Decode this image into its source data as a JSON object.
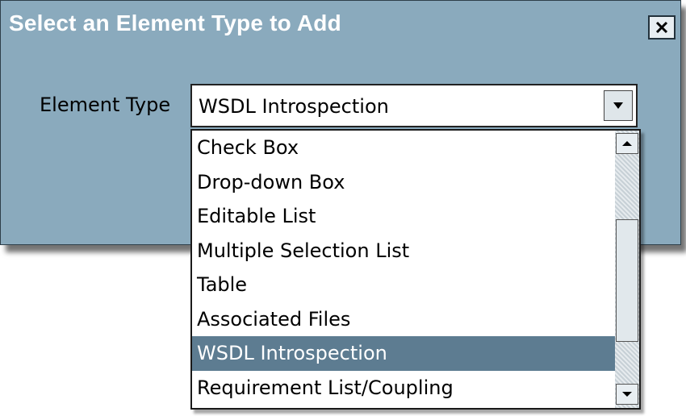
{
  "dialog": {
    "title": "Select an Element Type to Add",
    "close_icon": "close-icon"
  },
  "form": {
    "element_type_label": "Element Type",
    "element_type_value": "WSDL Introspection"
  },
  "dropdown": {
    "items": [
      "Check Box",
      "Drop-down Box",
      "Editable List",
      "Multiple Selection List",
      "Table",
      "Associated Files",
      "WSDL Introspection",
      "Requirement List/Coupling"
    ],
    "selected_index": 6
  },
  "colors": {
    "dialog_background": "#8aaabd",
    "title_text": "#ffffff",
    "selection_background": "#5d7c91",
    "selection_text": "#ffffff"
  }
}
